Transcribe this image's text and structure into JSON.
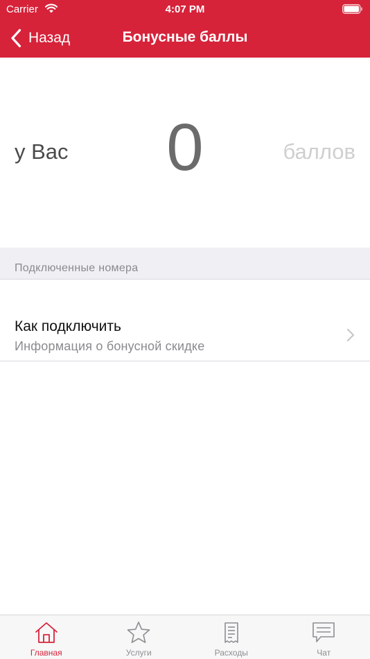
{
  "status_bar": {
    "carrier": "Carrier",
    "time": "4:07 PM"
  },
  "nav": {
    "back_label": "Назад",
    "title": "Бонусные баллы"
  },
  "points": {
    "prefix": "у Вас",
    "value": "0",
    "suffix": "баллов"
  },
  "section": {
    "header": "Подключенные номера"
  },
  "row": {
    "title": "Как подключить",
    "subtitle": "Информация о бонусной скидке"
  },
  "tabs": [
    {
      "label": "Главная",
      "icon": "home-icon",
      "active": true
    },
    {
      "label": "Услуги",
      "icon": "star-icon",
      "active": false
    },
    {
      "label": "Расходы",
      "icon": "receipt-icon",
      "active": false
    },
    {
      "label": "Чат",
      "icon": "chat-icon",
      "active": false
    }
  ],
  "colors": {
    "brand_red": "#d6233a",
    "tab_inactive": "#8e8e93",
    "section_background": "#efeff4"
  }
}
